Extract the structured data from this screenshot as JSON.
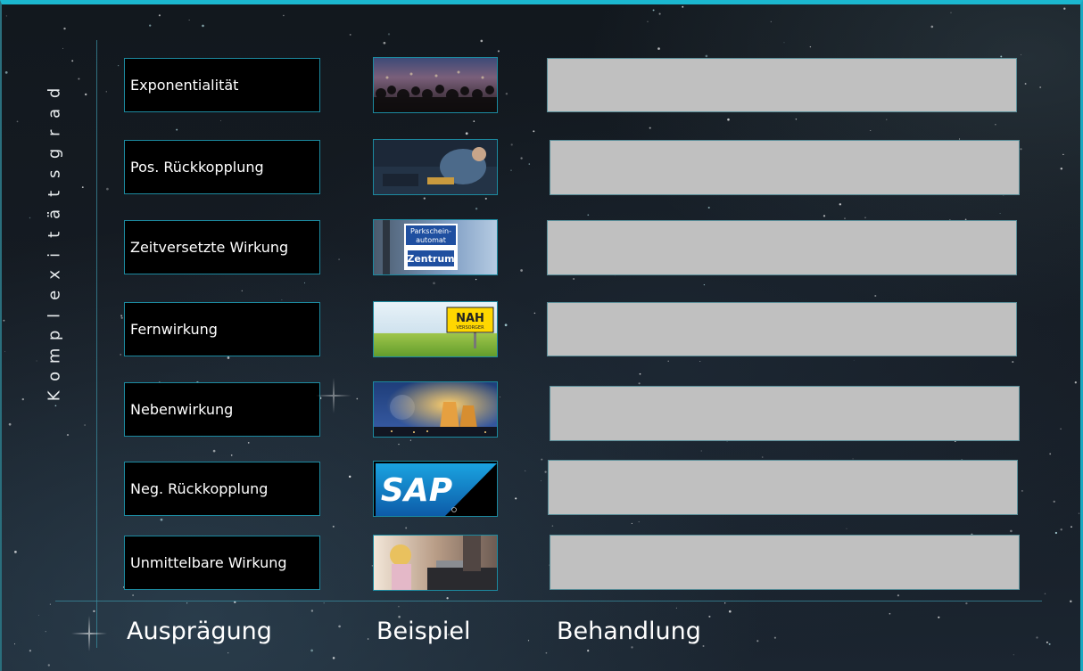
{
  "axis": {
    "y_label_letters": [
      "K",
      "o",
      "m",
      "p",
      "l",
      "e",
      "x",
      "i",
      "t",
      "ä",
      "t",
      "s",
      "g",
      "r",
      "a",
      "d"
    ]
  },
  "columns": {
    "auspraegung": "Ausprägung",
    "beispiel": "Beispiel",
    "behandlung": "Behandlung"
  },
  "rows": [
    {
      "label": "Exponentialität",
      "example_icon": "crowd-photo"
    },
    {
      "label": "Pos. Rückkopplung",
      "example_icon": "person-on-sofa-photo"
    },
    {
      "label": "Zeitversetzte Wirkung",
      "example_icon": "parking-sign-photo",
      "sign_line1": "Parkschein-",
      "sign_line2": "automat",
      "sign_line3": "Zentrum"
    },
    {
      "label": "Fernwirkung",
      "example_icon": "field-sign-photo",
      "sign_text": "NAH",
      "sign_sub": "VERSORGER"
    },
    {
      "label": "Nebenwirkung",
      "example_icon": "nuclear-plant-photo"
    },
    {
      "label": "Neg. Rückkopplung",
      "example_icon": "sap-logo",
      "logo_text": "SAP"
    },
    {
      "label": "Unmittelbare Wirkung",
      "example_icon": "child-stove-photo"
    }
  ],
  "colors": {
    "accent": "#1bb7cf",
    "box_bg": "#000000",
    "treatment_fill": "#c0c0c0"
  }
}
